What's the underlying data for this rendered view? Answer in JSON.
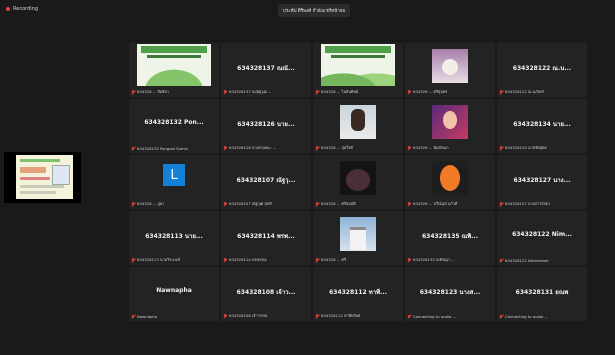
{
  "recording": {
    "label": "Recording"
  },
  "share_banner": {
    "text": "ประทีป ศิริพงศ์ กำลังแชร์หน้าจอ"
  },
  "tiles": [
    {
      "kind": "slide",
      "display": "",
      "label": "634328 ... ปิยธิดา"
    },
    {
      "kind": "name",
      "display": "634328137 ณณั...",
      "label": "634328137 ณณัฐวุฒิ ..."
    },
    {
      "kind": "slide2",
      "display": "",
      "label": "634328 ... ไพลินทิพย์"
    },
    {
      "kind": "cat",
      "display": "",
      "label": "634328 ... ศรีสุนทร"
    },
    {
      "kind": "name",
      "display": "634328122 ณ.น...",
      "label": "634328122 ณ.นภัสสร"
    },
    {
      "kind": "name",
      "display": "634328132 Pon...",
      "label": "634328132 Pongsat Sumsi"
    },
    {
      "kind": "name",
      "display": "634328126 นาย...",
      "label": "634328126 นายกฤษณะ ..."
    },
    {
      "kind": "girl1",
      "display": "",
      "label": "634328 ... สุดใจดี"
    },
    {
      "kind": "girl2",
      "display": "",
      "label": "634328 ... พิมพ์ชนก"
    },
    {
      "kind": "name",
      "display": "634328134 นาย...",
      "label": "634328134 นายชัยยุทธ"
    },
    {
      "kind": "L",
      "display": "L",
      "label": "634328 ... ภูผา"
    },
    {
      "kind": "name",
      "display": "634328107 ณัฐวุ...",
      "label": "634328107 ณัฐวุฒิ สุขดี"
    },
    {
      "kind": "dark",
      "display": "",
      "label": "634328 ... ศรีสมบัติ"
    },
    {
      "kind": "orange",
      "display": "",
      "label": "634328 ... ปวีณ์นุช แก้วดี"
    },
    {
      "kind": "name",
      "display": "634328127 นาง...",
      "label": "634328127 นางสาวกัลยา"
    },
    {
      "kind": "name",
      "display": "634328113 นาย...",
      "label": "634328113 นายวีระพงษ์"
    },
    {
      "kind": "name",
      "display": "634328114 พรพ...",
      "label": "634328114 พรพรรณ"
    },
    {
      "kind": "house",
      "display": "",
      "label": "634328 ... ศรี"
    },
    {
      "kind": "name",
      "display": "634328135 ณพิ...",
      "label": "634328135 ณพิชญา ..."
    },
    {
      "kind": "name",
      "display": "634328122 Nim...",
      "label": "634328122 Nimmanee"
    },
    {
      "kind": "name",
      "display": "Nawnapha",
      "label": "Nawnapha"
    },
    {
      "kind": "name",
      "display": "634328108 เจ้าว...",
      "label": "634328108 เจ้าวรรณ"
    },
    {
      "kind": "name",
      "display": "634328112 ทาพี...",
      "label": "634328112 ทาพีทรัพย์"
    },
    {
      "kind": "name",
      "display": "634328123 นางส...",
      "label": "Connecting to audio ..."
    },
    {
      "kind": "name",
      "display": "634328131 ยณพ",
      "label": "Connecting to audio ..."
    }
  ],
  "colors": {
    "background": "#1a1a1a",
    "tile": "#232323",
    "muted": "#e0463c",
    "accent": "#1382d6"
  }
}
